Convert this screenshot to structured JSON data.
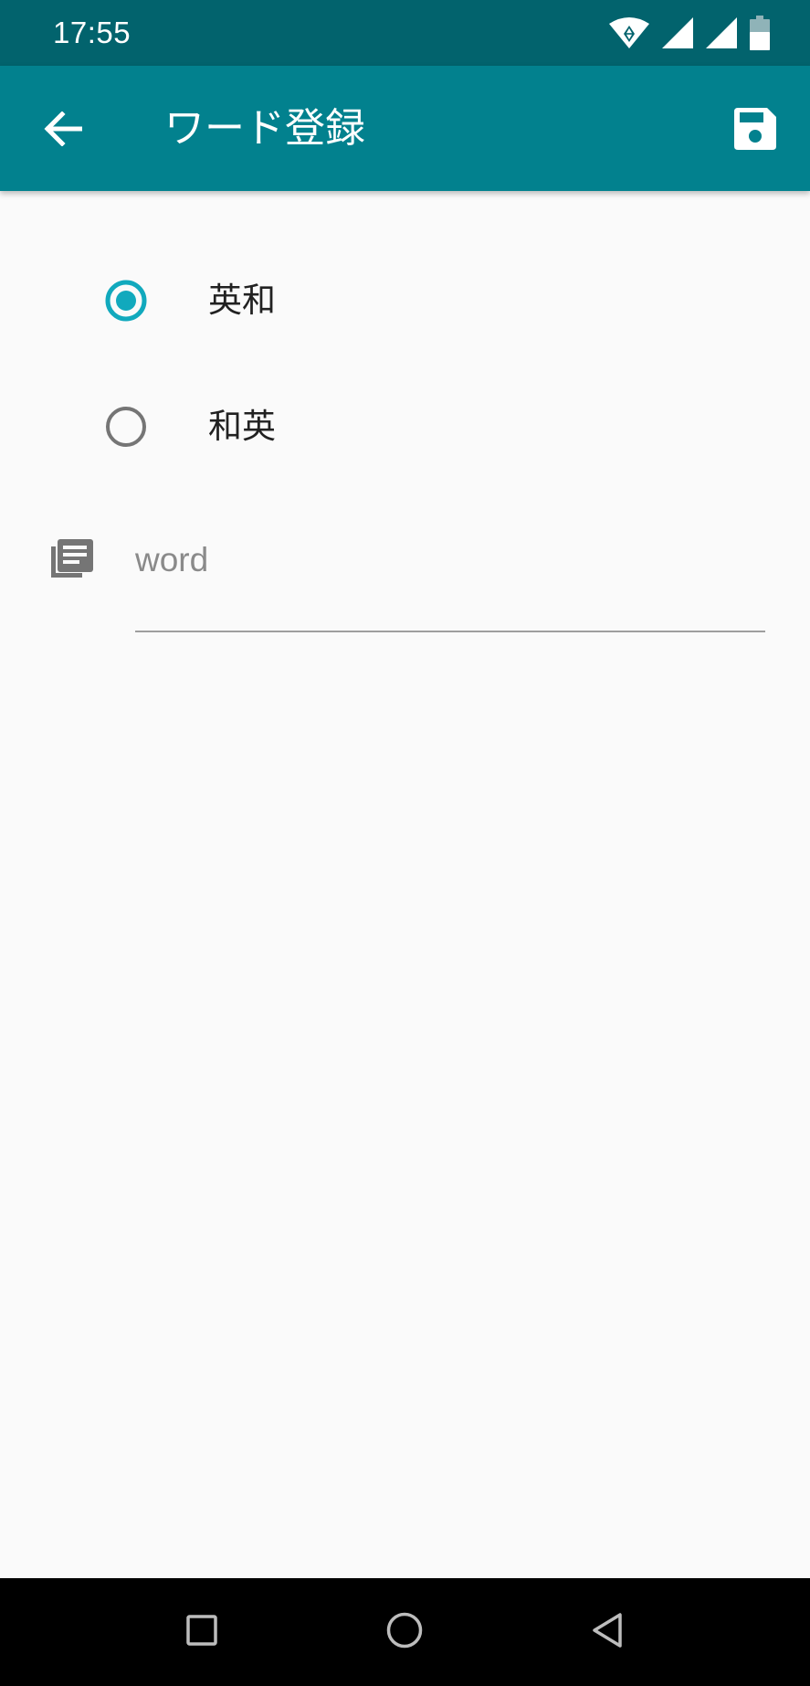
{
  "status_bar": {
    "time": "17:55",
    "icons": [
      "wifi-icon",
      "signal-icon",
      "signal-icon",
      "battery-icon"
    ]
  },
  "app_bar": {
    "back_icon": "arrow-back-icon",
    "title": "ワード登録",
    "save_icon": "save-icon"
  },
  "direction": {
    "options": [
      {
        "label": "英和",
        "selected": true
      },
      {
        "label": "和英",
        "selected": false
      }
    ]
  },
  "word_field": {
    "icon": "library-books-icon",
    "value": "",
    "placeholder": "word"
  },
  "nav_bar": {
    "buttons": [
      "recents-icon",
      "home-icon",
      "back-icon"
    ]
  },
  "colors": {
    "status_bar": "#02636d",
    "app_bar": "#02818e",
    "accent": "#11a9bd",
    "background": "#fafafa"
  }
}
